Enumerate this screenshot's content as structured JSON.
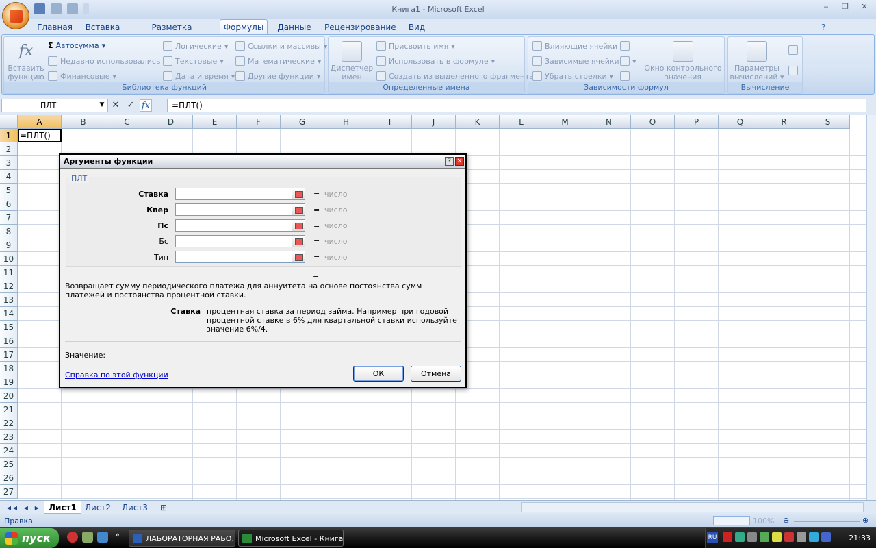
{
  "window": {
    "title": "Книга1 - Microsoft Excel"
  },
  "ribbon_tabs": [
    "Главная",
    "Вставка",
    "Разметка страницы",
    "Формулы",
    "Данные",
    "Рецензирование",
    "Вид"
  ],
  "active_tab": "Формулы",
  "ribbon": {
    "insert_function": "Вставить функцию",
    "autosum": "Автосумма",
    "recently_used": "Недавно использовались",
    "financial": "Финансовые",
    "logical": "Логические",
    "text": "Текстовые",
    "date_time": "Дата и время",
    "lookup": "Ссылки и массивы",
    "math": "Математические",
    "more_functions": "Другие функции",
    "group_library": "Библиотека функций",
    "name_manager": "Диспетчер имен",
    "define_name": "Присвоить имя",
    "use_in_formula": "Использовать в формуле",
    "create_from_selection": "Создать из выделенного фрагмента",
    "group_names": "Определенные имена",
    "trace_precedents": "Влияющие ячейки",
    "trace_dependents": "Зависимые ячейки",
    "remove_arrows": "Убрать стрелки",
    "watch_window": "Окно контрольного значения",
    "group_auditing": "Зависимости формул",
    "calc_options": "Параметры вычислений",
    "group_calc": "Вычисление"
  },
  "formula_bar": {
    "name_box": "ПЛТ",
    "formula": "=ПЛТ()"
  },
  "grid": {
    "columns": [
      "A",
      "B",
      "C",
      "D",
      "E",
      "F",
      "G",
      "H",
      "I",
      "J",
      "K",
      "L",
      "M",
      "N",
      "O",
      "P",
      "Q",
      "R",
      "S"
    ],
    "rows": [
      "1",
      "2",
      "3",
      "4",
      "5",
      "6",
      "7",
      "8",
      "9",
      "10",
      "11",
      "12",
      "13",
      "14",
      "15",
      "16",
      "17",
      "18",
      "19",
      "20",
      "21",
      "22",
      "23",
      "24",
      "25",
      "26",
      "27"
    ],
    "a1": "=ПЛТ()"
  },
  "dialog": {
    "title": "Аргументы функции",
    "function_name": "ПЛТ",
    "args": [
      {
        "label": "Ставка",
        "value": "число"
      },
      {
        "label": "Кпер",
        "value": "число"
      },
      {
        "label": "Пс",
        "value": "число"
      },
      {
        "label": "Бс",
        "value": "число"
      },
      {
        "label": "Тип",
        "value": "число"
      }
    ],
    "eq": "=",
    "description": "Возвращает сумму периодического платежа для аннуитета на основе постоянства сумм платежей и постоянства процентной ставки.",
    "current_arg": "Ставка",
    "current_arg_desc": "процентная ставка за период займа. Например при годовой процентной ставке в 6% для квартальной ставки используйте значение 6%/4.",
    "value_label": "Значение:",
    "help_link": "Справка по этой функции",
    "ok": "ОК",
    "cancel": "Отмена",
    "help_icon": "?",
    "close_icon": "✕"
  },
  "sheet_tabs": [
    "Лист1",
    "Лист2",
    "Лист3"
  ],
  "status": {
    "mode": "Правка",
    "zoom": "100%"
  },
  "taskbar": {
    "start": "пуск",
    "items": [
      "ЛАБОРАТОРНАЯ РАБО...",
      "Microsoft Excel - Книга1"
    ],
    "lang": "RU",
    "clock": "21:33"
  }
}
